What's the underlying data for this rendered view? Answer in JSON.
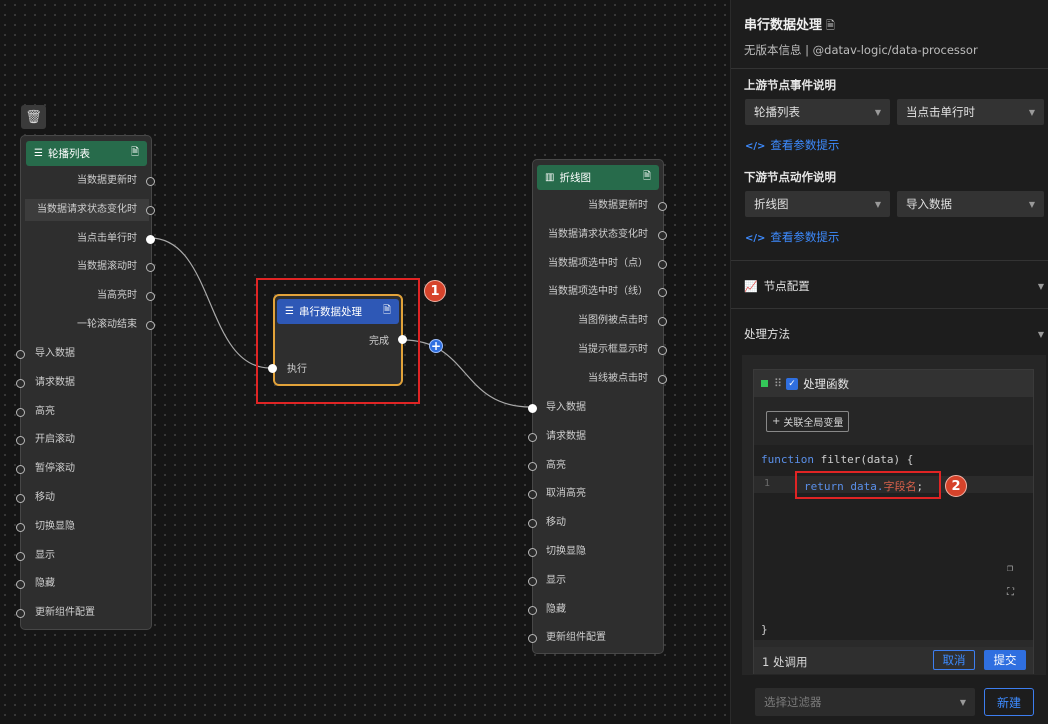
{
  "canvas": {
    "carousel_node": {
      "title": "轮播列表",
      "events": [
        "当数据更新时",
        "当数据请求状态变化时",
        "当点击单行时",
        "当数据滚动时",
        "当高亮时",
        "一轮滚动结束"
      ],
      "actions": [
        "导入数据",
        "请求数据",
        "高亮",
        "开启滚动",
        "暂停滚动",
        "移动",
        "切换显隐",
        "显示",
        "隐藏",
        "更新组件配置"
      ]
    },
    "serial_node": {
      "title": "串行数据处理",
      "output": "完成",
      "input": "执行"
    },
    "line_node": {
      "title": "折线图",
      "events": [
        "当数据更新时",
        "当数据请求状态变化时",
        "当数据项选中时（点）",
        "当数据项选中时（线）",
        "当图例被点击时",
        "当提示框显示时",
        "当线被点击时"
      ],
      "actions": [
        "导入数据",
        "请求数据",
        "高亮",
        "取消高亮",
        "移动",
        "切换显隐",
        "显示",
        "隐藏",
        "更新组件配置"
      ]
    },
    "badges": [
      "1",
      "2"
    ],
    "plus_label": "+"
  },
  "panel": {
    "title": "串行数据处理",
    "subtitle": "无版本信息 | @datav-logic/data-processor",
    "upstream": {
      "label": "上游节点事件说明",
      "select_node": "轮播列表",
      "select_event": "当点击单行时",
      "link": "查看参数提示"
    },
    "downstream": {
      "label": "下游节点动作说明",
      "select_node": "折线图",
      "select_action": "导入数据",
      "link": "查看参数提示"
    },
    "node_config": "节点配置",
    "process_method": "处理方法",
    "func_card": {
      "title": "处理函数",
      "global_var_btn": "关联全局变量",
      "code_kw": "function",
      "code_sig_rest": " filter(data) {",
      "line_number": "1",
      "ret_kw": "return",
      "ret_obj": " data.",
      "ret_field": "字段名",
      "ret_end": ";",
      "close": "}",
      "usage": "1 处调用",
      "cancel": "取消",
      "submit": "提交"
    },
    "filter_placeholder": "选择过滤器",
    "new_button": "新建"
  },
  "colors": {
    "accent": "#2f6fe0",
    "highlight_border": "#e02424",
    "carousel_header": "#276b4b",
    "serial_header": "#2e58b6",
    "serial_border": "#e3a33a"
  }
}
